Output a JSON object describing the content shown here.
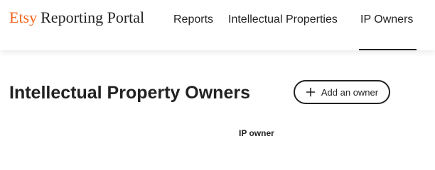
{
  "header": {
    "brand_logo": "Etsy",
    "brand_title": "Reporting Portal",
    "nav": {
      "reports": "Reports",
      "intellectual_properties": "Intellectual Properties",
      "ip_owners": "IP Owners"
    },
    "active_nav": "IP Owners"
  },
  "main": {
    "page_title": "Intellectual Property Owners",
    "add_button_label": "Add an owner",
    "table": {
      "columns": [
        "IP owner"
      ]
    }
  },
  "icons": {
    "add": "plus-icon"
  },
  "colors": {
    "brand_orange": "#f1641e",
    "text": "#222222",
    "background": "#ffffff"
  }
}
